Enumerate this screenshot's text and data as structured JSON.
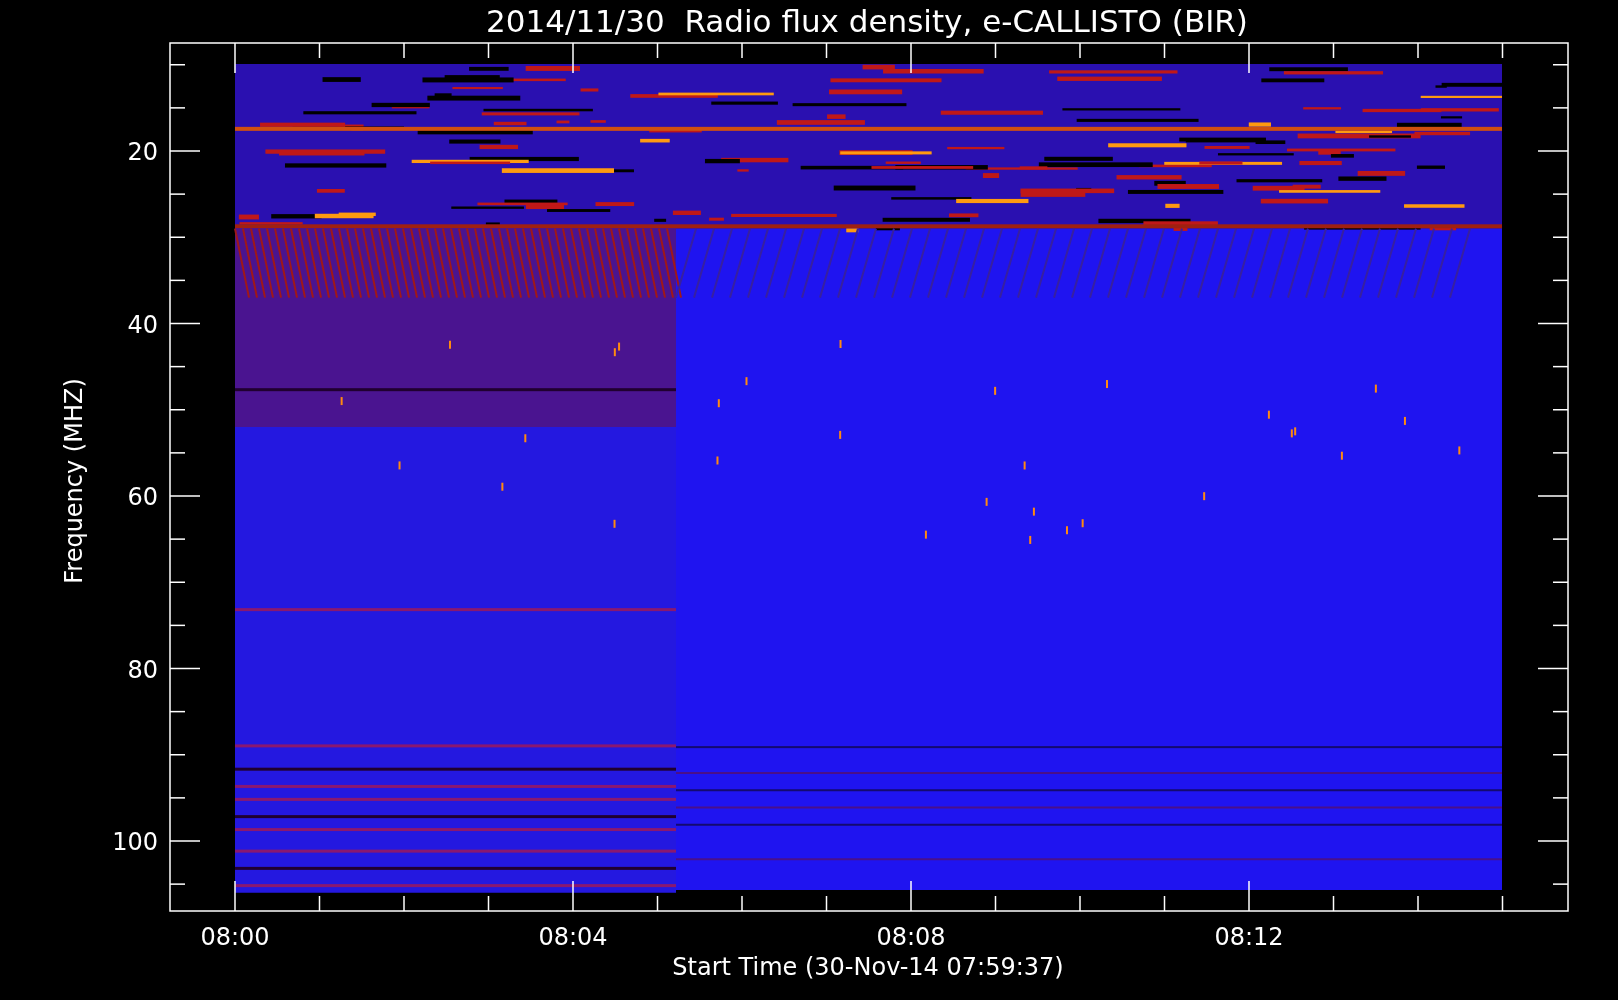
{
  "title": "2014/11/30  Radio flux density, e-CALLISTO (BIR)",
  "y_axis": {
    "label": "Frequency (MHZ)",
    "ticks": [
      "20",
      "40",
      "60",
      "80",
      "100"
    ]
  },
  "x_axis": {
    "label": "Start Time (30-Nov-14 07:59:37)",
    "ticks": [
      "08:00",
      "08:04",
      "08:08",
      "08:12"
    ]
  }
}
